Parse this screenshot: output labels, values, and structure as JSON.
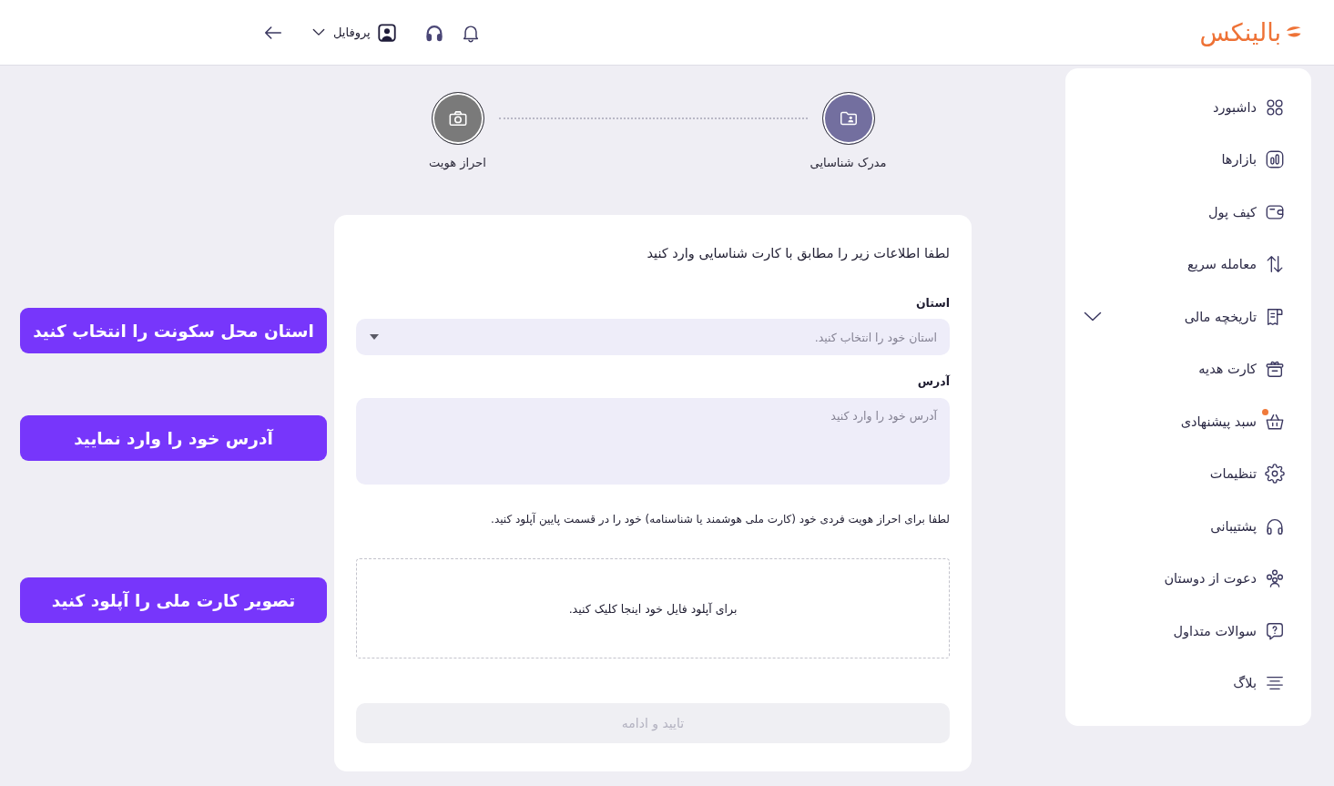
{
  "header": {
    "logo": {
      "text": "بالینکس"
    },
    "profile": {
      "label": "پروفایل"
    }
  },
  "sidebar": {
    "items": [
      {
        "label": "داشبورد",
        "kind": "link",
        "notify": false
      },
      {
        "label": "بازارها",
        "kind": "link",
        "notify": false
      },
      {
        "label": "کیف پول",
        "kind": "link",
        "notify": false
      },
      {
        "label": "معامله سریع",
        "kind": "link",
        "notify": false
      },
      {
        "label": "تاریخچه مالی",
        "kind": "group",
        "expanded": false,
        "notify": false
      },
      {
        "label": "کارت هدیه",
        "kind": "link",
        "notify": false
      },
      {
        "label": "سبد پیشنهادی",
        "kind": "link",
        "notify": true
      },
      {
        "label": "تنظیمات",
        "kind": "link",
        "notify": false
      },
      {
        "label": "پشتیبانی",
        "kind": "link",
        "notify": false
      },
      {
        "label": "دعوت از دوستان",
        "kind": "link",
        "notify": false
      },
      {
        "label": "سوالات متداول",
        "kind": "link",
        "notify": false
      },
      {
        "label": "بلاگ",
        "kind": "link",
        "notify": false
      }
    ]
  },
  "stepper": {
    "steps": [
      {
        "label": "مدرک شناسایی",
        "active": true
      },
      {
        "label": "احراز هویت",
        "active": false
      }
    ]
  },
  "form": {
    "title": "لطفا اطلاعات زیر را مطابق با کارت شناسایی وارد کنید",
    "fields": [
      {
        "kind": "select",
        "label": "استان",
        "placeholder": "استان خود را انتخاب کنید."
      },
      {
        "kind": "textarea",
        "label": "آدرس",
        "placeholder": "آدرس خود را وارد کنید"
      }
    ],
    "upload_note": "لطفا برای احراز هویت فردی خود (کارت ملی هوشمند یا شناسنامه) خود را در قسمت پایین آپلود کنید.",
    "upload": {
      "prompt": "برای آپلود فایل خود اینجا کلیک کنید."
    },
    "submit": {
      "label": "تایید و ادامه",
      "disabled": true
    }
  },
  "annotations": [
    {
      "text": "استان محل سکونت را انتخاب کنید"
    },
    {
      "text": "آدرس خود را وارد نمایید"
    },
    {
      "text": "تصویر کارت ملی را آپلود کنید"
    }
  ]
}
